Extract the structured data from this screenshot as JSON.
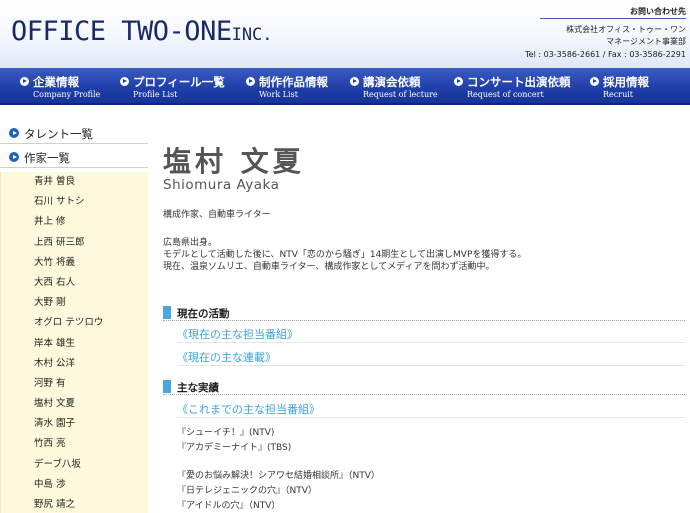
{
  "header": {
    "logo_main": "OFFICE TWO-ONE",
    "logo_suffix": "INC.",
    "contact_label": "お問い合わせ先",
    "company": "株式会社オフィス・トゥー・ワン",
    "division": "マネージメント事業部",
    "phone": "Tel : 03-3586-2661 / Fax : 03-3586-2291"
  },
  "nav": [
    {
      "jp": "企業情報",
      "en": "Company Profile"
    },
    {
      "jp": "プロフィール一覧",
      "en": "Profile List"
    },
    {
      "jp": "制作作品情報",
      "en": "Work List"
    },
    {
      "jp": "講演会依頼",
      "en": "Request of lecture"
    },
    {
      "jp": "コンサート出演依頼",
      "en": "Request of concert"
    },
    {
      "jp": "採用情報",
      "en": "Recruit"
    }
  ],
  "sidebar": {
    "talent_label": "タレント一覧",
    "writer_label": "作家一覧",
    "writers": [
      "青井 曽良",
      "石川 サトシ",
      "井上 修",
      "上西 研三郎",
      "大竹 将義",
      "大西 右人",
      "大野 剛",
      "オグロ テツロウ",
      "岸本 雄生",
      "木村 公洋",
      "河野 有",
      "塩村 文夏",
      "清水 園子",
      "竹西 亮",
      "デーブ八坂",
      "中島 渉",
      "野尻 靖之"
    ]
  },
  "profile": {
    "name_jp": "塩村 文夏",
    "name_en": "Shiomura Ayaka",
    "role": "構成作家、自動車ライター",
    "bio": [
      "広島県出身。",
      "モデルとして活動した後に、NTV「恋のから騒ぎ」14期生として出演しMVPを獲得する。",
      "現在、温泉ソムリエ、自動車ライター、構成作家としてメディアを問わず活動中。"
    ]
  },
  "sections": {
    "current_title": "現在の活動",
    "current_programs": "《現在の主な担当番組》",
    "current_series": "《現在の主な連載》",
    "achievements_title": "主な実績",
    "past_programs": "《これまでの主な担当番組》",
    "works": [
      "『シューイチ！』(NTV)",
      "『アカデミーナイト』(TBS)",
      "『愛のお悩み解決！シアワセ結婚相談所』（NTV）",
      "『日テレジェニックの穴』（NTV）",
      "『アイドルの穴』（NTV）"
    ]
  }
}
